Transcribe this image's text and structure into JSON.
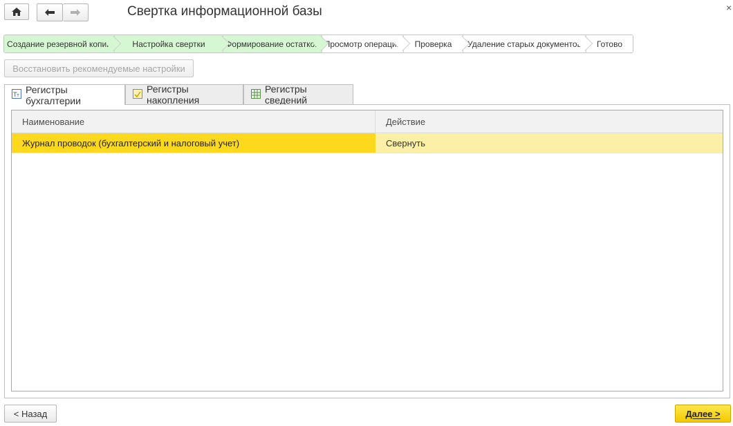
{
  "window": {
    "title": "Свертка информационной базы",
    "close_glyph": "×"
  },
  "nav": {
    "home_icon": "home-icon",
    "back_icon": "arrow-left-icon",
    "forward_icon": "arrow-right-icon"
  },
  "steps": [
    {
      "label": "Создание резервной копии",
      "done": true
    },
    {
      "label": "Настройка свертки",
      "done": true
    },
    {
      "label": "Формирование остатков",
      "done": true
    },
    {
      "label": "Просмотр операций",
      "done": false
    },
    {
      "label": "Проверка",
      "done": false
    },
    {
      "label": "Удаление старых документов",
      "done": false
    },
    {
      "label": "Готово",
      "done": false
    }
  ],
  "restore_button": {
    "label": "Восстановить рекомендуемые настройки"
  },
  "tabs": [
    {
      "label": "Регистры бухгалтерии",
      "icon": "accounting-register-icon",
      "active": true
    },
    {
      "label": "Регистры накопления",
      "icon": "accumulation-register-icon",
      "active": false
    },
    {
      "label": "Регистры сведений",
      "icon": "information-register-icon",
      "active": false
    }
  ],
  "table": {
    "columns": [
      "Наименование",
      "Действие"
    ],
    "rows": [
      {
        "name": "Журнал проводок (бухгалтерский и налоговый учет)",
        "action": "Свернуть",
        "selected": true
      }
    ]
  },
  "footer": {
    "back_label": "< Назад",
    "next_label": "Далее >"
  },
  "colors": {
    "done_step": "#d5f7d1",
    "selected_cell": "#fcd91c",
    "selected_row": "#fbf0a5",
    "primary_button": "#f5c800"
  }
}
